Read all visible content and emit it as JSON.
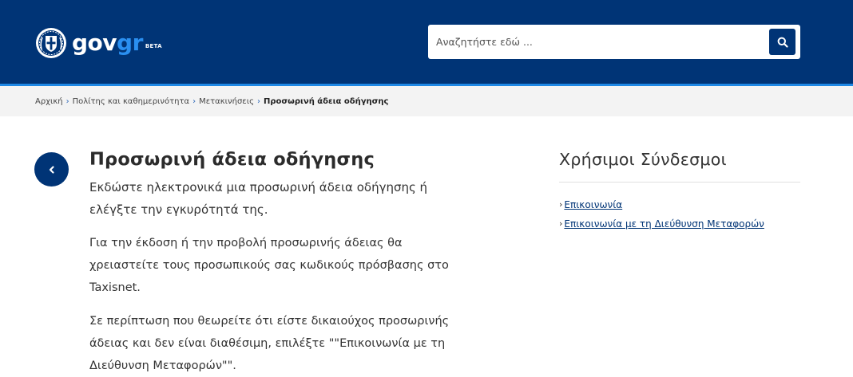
{
  "header": {
    "logo_gov": "gov",
    "logo_gr": "gr",
    "logo_beta": "BETA",
    "emblem_icon": "greek-coat-of-arms-icon",
    "search_placeholder": "Αναζητήστε εδώ ...",
    "search_icon": "search-icon",
    "brand_color": "#003476",
    "accent_color": "#1e88e5"
  },
  "breadcrumb": {
    "items": [
      "Αρχική",
      "Πολίτης και καθημερινότητα",
      "Μετακινήσεις"
    ],
    "current": "Προσωρινή άδεια οδήγησης",
    "separator": "›"
  },
  "main": {
    "back_icon": "chevron-left-icon",
    "title": "Προσωρινή άδεια οδήγησης",
    "lead": "Εκδώστε ηλεκτρονικά μια προσωρινή άδεια οδήγησης ή ελέγξτε την εγκυρότητά της.",
    "paragraphs": [
      "Για την έκδοση ή την προβολή προσωρινής άδειας θα χρειαστείτε τους προσωπικούς σας κωδικούς πρόσβασης στο Taxisnet.",
      "Σε περίπτωση που θεωρείτε ότι είστε δικαιούχος προσωρινής άδειας και δεν είναι διαθέσιμη, επιλέξτε \"\"Επικοινωνία με τη Διεύθυνση Μεταφορών\"\"."
    ]
  },
  "aside": {
    "title": "Χρήσιμοι Σύνδεσμοι",
    "links": [
      "Επικοινωνία",
      "Επικοινωνία με τη Διεύθυνση Μεταφορών"
    ]
  }
}
